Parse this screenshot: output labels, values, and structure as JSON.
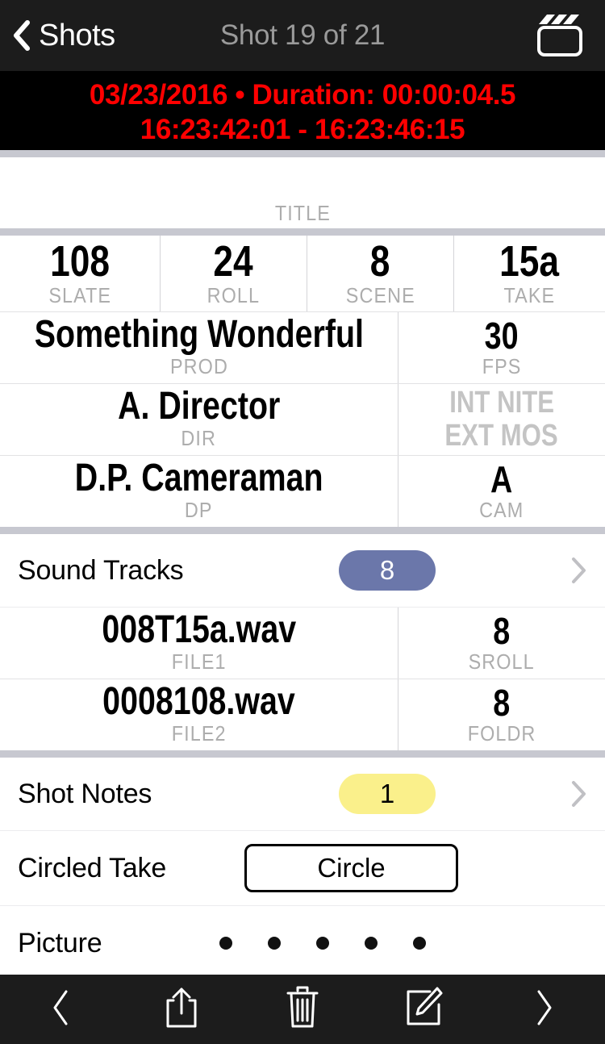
{
  "navbar": {
    "back_label": "Shots",
    "back_icon": "chevron-left-icon",
    "title": "Shot 19 of 21",
    "right_icon": "clapperboard-icon"
  },
  "timecode_banner": {
    "line1": "03/23/2016 • Duration: 00:00:04.5",
    "line2": "16:23:42:01 - 16:23:46:15",
    "color": "#ff0000",
    "background": "#000000"
  },
  "slate": {
    "title_field": {
      "value": "",
      "label": "TITLE"
    },
    "row_ids": [
      {
        "value": "108",
        "label": "SLATE"
      },
      {
        "value": "24",
        "label": "ROLL"
      },
      {
        "value": "8",
        "label": "SCENE"
      },
      {
        "value": "15a",
        "label": "TAKE"
      }
    ],
    "row_prod": {
      "left": {
        "value": "Something Wonderful",
        "label": "PROD"
      },
      "right": {
        "value": "30",
        "label": "FPS"
      }
    },
    "row_dir": {
      "left": {
        "value": "A. Director",
        "label": "DIR"
      },
      "right": {
        "value_line1": "INT NITE",
        "value_line2": "EXT MOS",
        "label": "",
        "is_placeholder": true
      }
    },
    "row_dp": {
      "left": {
        "value": "D.P. Cameraman",
        "label": "DP"
      },
      "right": {
        "value": "A",
        "label": "CAM"
      }
    }
  },
  "sound": {
    "header": {
      "label": "Sound Tracks",
      "badge": "8",
      "badge_color": "#6b77aa",
      "disclosure_icon": "chevron-right-icon"
    },
    "row_file1": {
      "left": {
        "value": "008T15a.wav",
        "label": "FILE1"
      },
      "right": {
        "value": "8",
        "label": "SROLL"
      }
    },
    "row_file2": {
      "left": {
        "value": "0008108.wav",
        "label": "FILE2"
      },
      "right": {
        "value": "8",
        "label": "FOLDR"
      }
    }
  },
  "options": {
    "shot_notes": {
      "label": "Shot Notes",
      "badge": "1",
      "badge_color": "#faf08b",
      "disclosure_icon": "chevron-right-icon"
    },
    "circled_take": {
      "label": "Circled Take",
      "button_label": "Circle"
    },
    "picture": {
      "label": "Picture",
      "dot_count": 5
    }
  },
  "toolbar": {
    "items": [
      {
        "name": "previous-button",
        "icon": "chevron-left-icon"
      },
      {
        "name": "share-button",
        "icon": "share-icon"
      },
      {
        "name": "delete-button",
        "icon": "trash-icon"
      },
      {
        "name": "edit-button",
        "icon": "compose-icon"
      },
      {
        "name": "next-button",
        "icon": "chevron-right-icon"
      }
    ]
  }
}
